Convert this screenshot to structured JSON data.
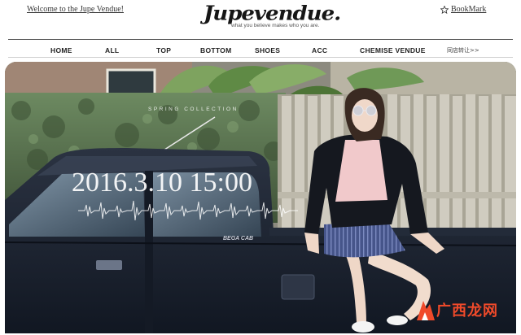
{
  "header": {
    "welcome_text": "Welcome to the Jupe Vendue!",
    "logo_name": "Jupevendue.",
    "logo_tagline": "what you believe makes who you are.",
    "bookmark_label": "BookMark",
    "bookmark_icon": "star-icon"
  },
  "nav": {
    "items": [
      "HOME",
      "ALL",
      "TOP",
      "BOTTOM",
      "SHOES",
      "ACC",
      "CHEMISE VENDUE"
    ],
    "extra": "同店转让>>"
  },
  "hero": {
    "collection_text": "SPRING COLLECTION",
    "date_text": "2016.3.10 15:00",
    "truck_badge": "BEGA CAB"
  },
  "watermark": {
    "text": "广西龙网",
    "icon": "mountain-logo-icon",
    "color": "#f04a2a"
  },
  "colors": {
    "truck": "#1b2230",
    "hedge": "#4f6847",
    "fence": "#c8c4b7"
  }
}
